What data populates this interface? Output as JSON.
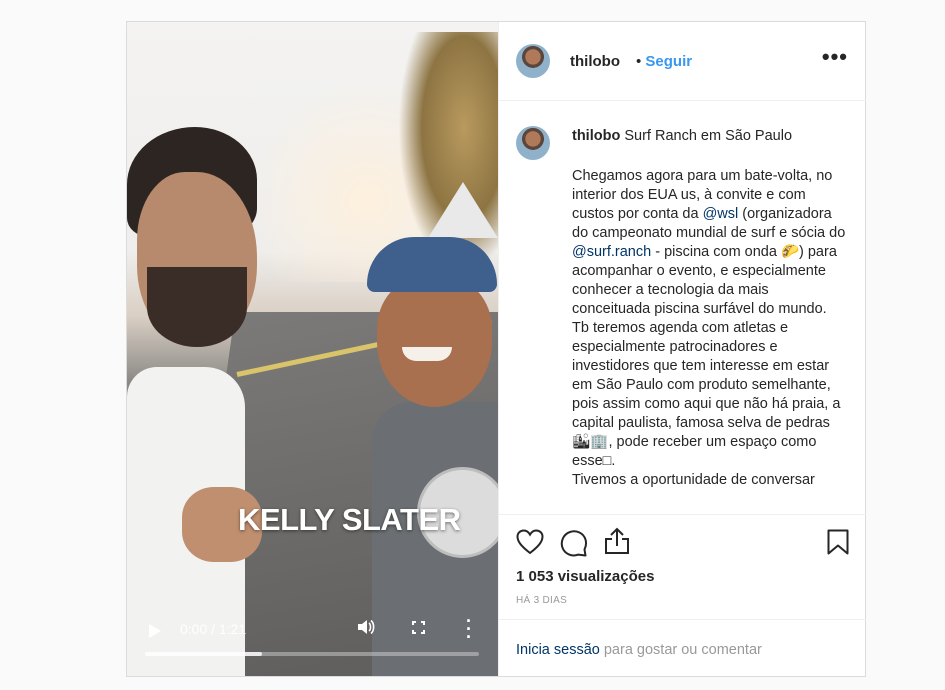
{
  "video": {
    "overlay_text": "KELLY SLATER",
    "time": "0:00 / 1:21",
    "progress": 0.35
  },
  "header": {
    "username": "thilobo",
    "separator": " • ",
    "follow_label": "Seguir",
    "more_label": "•••"
  },
  "caption": {
    "username": "thilobo",
    "title": "Surf Ranch em São Paulo",
    "body_1": "Chegamos agora para um bate-volta, no interior dos EUA us, à convite e com custos por conta da ",
    "mention_1": "@wsl",
    "body_2": " (organizadora do campeonato mundial de surf e sócia do ",
    "mention_2": "@surf.ranch",
    "body_3": " - piscina com onda 🌮) para acompanhar o evento, e especialmente conhecer a tecnologia da mais conceituada piscina surfável do mundo. Tb teremos agenda com atletas e especialmente patrocinadores e investidores que tem interesse em estar em São Paulo com produto semelhante, pois assim como aqui que não há praia, a capital paulista, famosa selva de pedras 🏙🏢, pode receber um espaço como esse□.",
    "body_4": "Tivemos a oportunidade de conversar"
  },
  "stats": {
    "views_count": "1 053",
    "views_label": " visualizações",
    "time_ago": "HÁ 3 DIAS"
  },
  "login": {
    "link_label": "Inicia sessão",
    "rest": " para gostar ou comentar"
  },
  "colors": {
    "accent": "#3897f0",
    "link": "#003569",
    "border": "#dbdbdb",
    "muted": "#999999"
  }
}
